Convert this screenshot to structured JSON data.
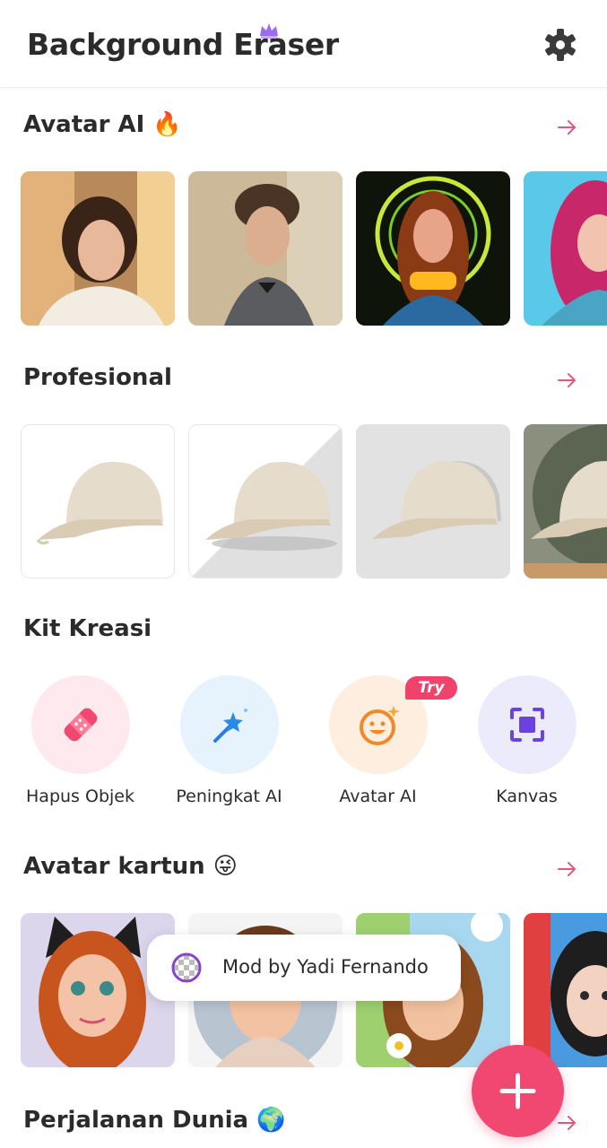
{
  "header": {
    "title": "Background Eraser",
    "settings_icon": "gear-icon",
    "crown_icon": "crown-icon"
  },
  "sections": {
    "avatar_ai": {
      "title": "Avatar AI",
      "emoji": "🔥"
    },
    "profesional": {
      "title": "Profesional"
    },
    "kit_kreasi": {
      "title": "Kit Kreasi"
    },
    "avatar_kartun": {
      "title": "Avatar kartun",
      "emoji": "😜"
    },
    "perjalanan_dunia": {
      "title": "Perjalanan Dunia",
      "emoji": "🌍"
    }
  },
  "tools": [
    {
      "label": "Hapus Objek",
      "icon": "bandage-eraser-icon",
      "bg": "#fde9ee"
    },
    {
      "label": "Peningkat AI",
      "icon": "magic-wand-icon",
      "bg": "#e6f3fd"
    },
    {
      "label": "Avatar AI",
      "icon": "smiley-icon",
      "bg": "#fdeee0",
      "badge": "Try"
    },
    {
      "label": "Kanvas",
      "icon": "canvas-frame-icon",
      "bg": "#ecebfc"
    }
  ],
  "toast": {
    "text": "Mod by Yadi Fernando",
    "icon": "transparency-checker-icon"
  },
  "fab": {
    "icon": "plus-icon"
  },
  "colors": {
    "accent": "#f04870",
    "arrow": "#e8557a",
    "text": "#2b2b2b"
  }
}
